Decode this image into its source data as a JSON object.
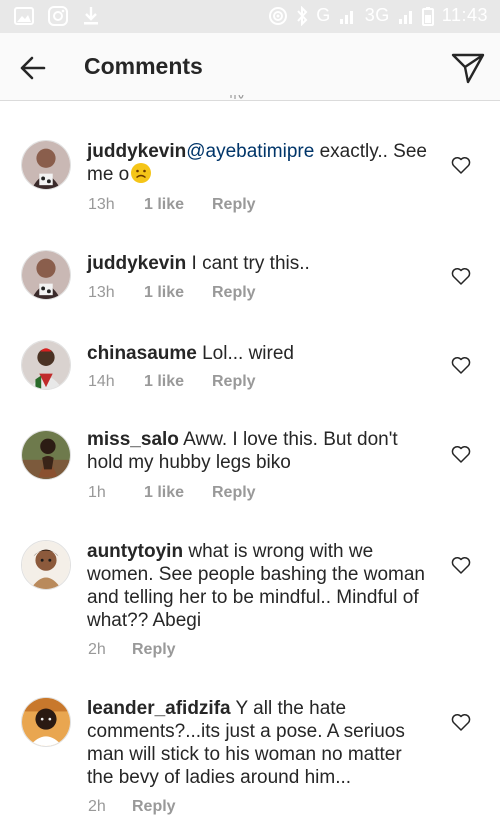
{
  "status_bar": {
    "time": "11:43",
    "network": "3G",
    "signal_label": "G"
  },
  "header": {
    "title": "Comments",
    "back_icon": "arrow-left-icon",
    "send_icon": "paper-plane-icon"
  },
  "comments": [
    {
      "username": "juddykevin",
      "mention": "@ayebatimipre",
      "text_line1": " exactly.. See",
      "text_line2": "me o",
      "emoji": "frowning-face",
      "time": "13h",
      "likes": "1 like",
      "reply": "Reply"
    },
    {
      "username": "juddykevin",
      "text": " I cant try this..",
      "time": "13h",
      "likes": "1 like",
      "reply": "Reply"
    },
    {
      "username": "chinasaume",
      "text": " Lol... wired",
      "time": "14h",
      "likes": "1 like",
      "reply": "Reply"
    },
    {
      "username": "miss_salo",
      "text_line1": " Aww. I love this. But don't",
      "text_line2": "hold my hubby legs biko",
      "time": "1h",
      "likes": "1 like",
      "reply": "Reply"
    },
    {
      "username": "auntytoyin",
      "text_line1": " what is wrong with we",
      "text_line2": "women. See people bashing the woman",
      "text_line3": "and telling her to be mindful.. Mindful of",
      "text_line4": "what?? Abegi",
      "time": "2h",
      "reply": "Reply"
    },
    {
      "username": "leander_afidzifa",
      "text_line1": " Y all the hate",
      "text_line2": "comments?...its just a pose.  A seriuos",
      "text_line3": "man will stick to his woman no matter",
      "text_line4": "the bevy of ladies around him...",
      "time": "2h",
      "reply": "Reply"
    }
  ],
  "colors": {
    "text": "#262626",
    "meta": "#999999",
    "mention": "#003569",
    "status_bar_bg": "#e8e8e8"
  }
}
